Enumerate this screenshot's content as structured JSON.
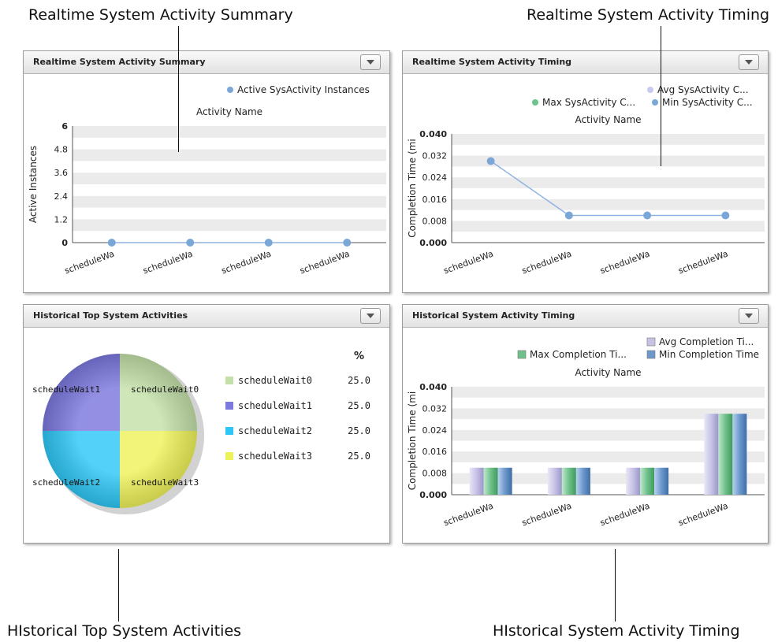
{
  "callouts": {
    "top_left": "Realtime System Activity Summary",
    "top_right": "Realtime System Activity Timing",
    "bottom_left": "HIstorical Top System Activities",
    "bottom_right": "HIstorical System Activity Timing"
  },
  "icons": {
    "panel_menu": "chevron-down-icon"
  },
  "panels": {
    "summary": {
      "title": "Realtime System Activity Summary"
    },
    "timing": {
      "title": "Realtime System Activity Timing"
    },
    "historical_top": {
      "title": "Historical Top System Activities"
    },
    "historical_timing": {
      "title": "Historical System Activity Timing"
    }
  },
  "colors": {
    "point_blue": "#7aa7d8",
    "line_blue": "#8fb3e0",
    "legend_green": "#6cc48c",
    "legend_lavender": "#c9c9f0",
    "pie_0": "#c3e0a8",
    "pie_1": "#7b78de",
    "pie_2": "#2ec7f5",
    "pie_3": "#eef25a",
    "bar_avg": "#c6c2e6",
    "bar_max": "#6fc08a",
    "bar_min": "#6c98cc"
  },
  "chart_data": [
    {
      "id": "realtime_summary",
      "type": "line",
      "title": "Activity Name",
      "xlabel": "",
      "ylabel": "Active Instances",
      "categories": [
        "scheduleWa",
        "scheduleWa",
        "scheduleWa",
        "scheduleWa"
      ],
      "series": [
        {
          "name": "Active SysActivity Instances",
          "values": [
            0,
            0,
            0,
            0
          ]
        }
      ],
      "ylim": [
        0,
        6
      ],
      "yticks": [
        "0",
        "1.2",
        "2.4",
        "3.6",
        "4.8",
        "6"
      ],
      "grid": true,
      "legend": "top-right"
    },
    {
      "id": "realtime_timing",
      "type": "line",
      "title": "Activity Name",
      "xlabel": "",
      "ylabel": "Completion Time (mi",
      "categories": [
        "scheduleWa",
        "scheduleWa",
        "scheduleWa",
        "scheduleWa"
      ],
      "series": [
        {
          "name": "Avg SysActivity C...",
          "values": [
            0.03,
            0.01,
            0.01,
            0.01
          ]
        },
        {
          "name": "Max SysActivity C...",
          "values": [
            0.03,
            0.01,
            0.01,
            0.01
          ]
        },
        {
          "name": "Min SysActivity C...",
          "values": [
            0.03,
            0.01,
            0.01,
            0.01
          ]
        }
      ],
      "ylim": [
        0,
        0.04
      ],
      "yticks": [
        "0.000",
        "0.008",
        "0.016",
        "0.024",
        "0.032",
        "0.040"
      ],
      "grid": true,
      "legend": "top-right"
    },
    {
      "id": "historical_top",
      "type": "pie",
      "percent_header": "%",
      "slices": [
        {
          "label": "scheduleWait0",
          "value": 25.0,
          "display": "25.0"
        },
        {
          "label": "scheduleWait1",
          "value": 25.0,
          "display": "25.0"
        },
        {
          "label": "scheduleWait2",
          "value": 25.0,
          "display": "25.0"
        },
        {
          "label": "scheduleWait3",
          "value": 25.0,
          "display": "25.0"
        }
      ],
      "legend": "right"
    },
    {
      "id": "historical_timing",
      "type": "bar",
      "title": "Activity Name",
      "xlabel": "",
      "ylabel": "Completion Time (mi",
      "categories": [
        "scheduleWa",
        "scheduleWa",
        "scheduleWa",
        "scheduleWa"
      ],
      "series": [
        {
          "name": "Avg Completion Ti...",
          "values": [
            0.01,
            0.01,
            0.01,
            0.03
          ]
        },
        {
          "name": "Max Completion Ti...",
          "values": [
            0.01,
            0.01,
            0.01,
            0.03
          ]
        },
        {
          "name": "Min Completion Time",
          "values": [
            0.01,
            0.01,
            0.01,
            0.03
          ]
        }
      ],
      "ylim": [
        0,
        0.04
      ],
      "yticks": [
        "0.000",
        "0.008",
        "0.016",
        "0.024",
        "0.032",
        "0.040"
      ],
      "grid": true,
      "legend": "top-right"
    }
  ]
}
